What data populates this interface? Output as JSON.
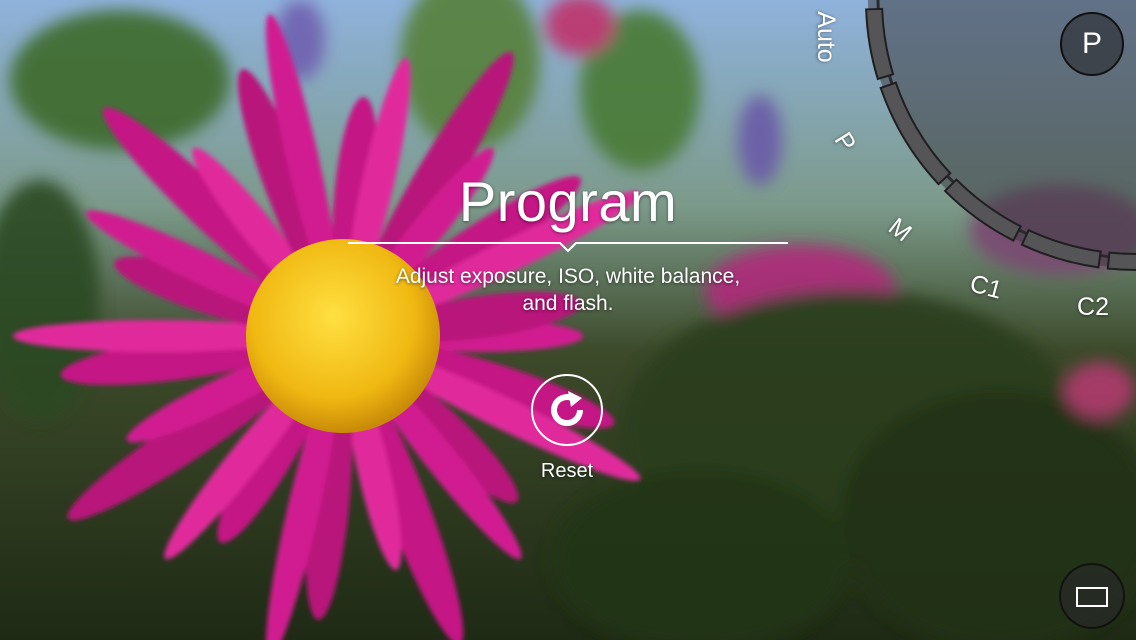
{
  "mode_panel": {
    "title": "Program",
    "description_line1": "Adjust exposure, ISO, white balance,",
    "description_line2": "and flash."
  },
  "reset": {
    "label": "Reset",
    "icon": "reset-icon"
  },
  "mode_dial": {
    "modes": [
      "Auto",
      "P",
      "M",
      "C1",
      "C2"
    ],
    "active_mode": "P",
    "current_mode_badge": "P"
  },
  "controls": {
    "aspect_icon": "aspect-ratio-icon"
  },
  "colors": {
    "accent": "#ffffff",
    "flower_petal": "#d01e90",
    "flower_center": "#f2c01a",
    "sky": "#8fb2dc"
  }
}
